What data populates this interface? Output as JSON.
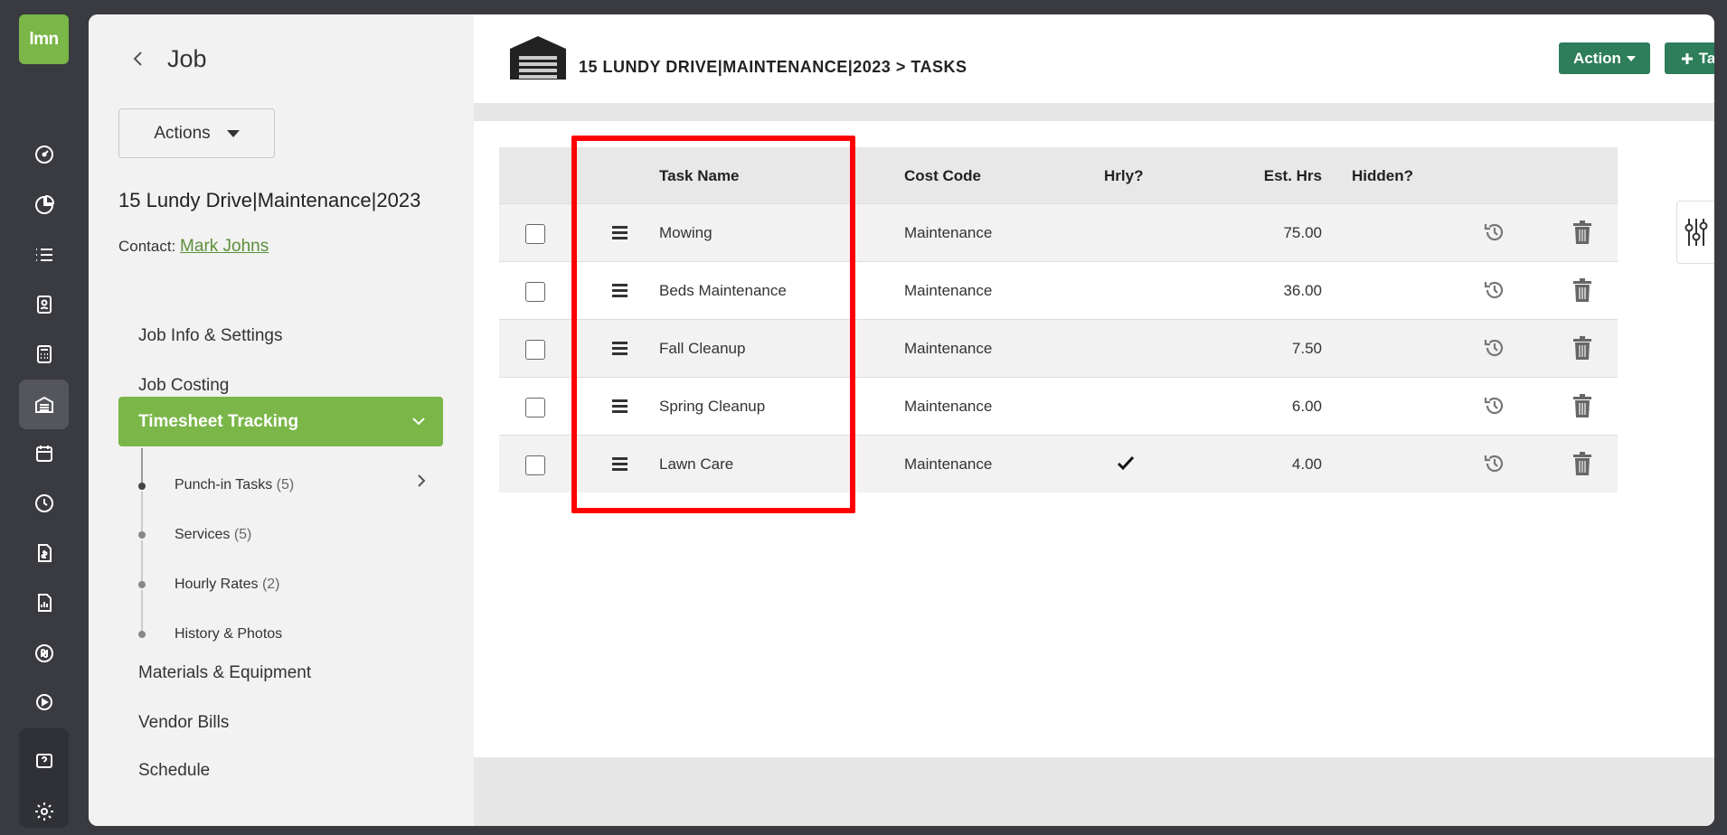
{
  "app": {
    "logo_text": "lmn"
  },
  "rail": {
    "icons": [
      "dashboard-icon",
      "pie-chart-icon",
      "list-icon",
      "contact-card-icon",
      "calculator-icon",
      "jobs-icon",
      "calendar-icon",
      "clock-icon",
      "invoice-icon",
      "report-icon",
      "quickbooks-icon",
      "play-icon",
      "help-icon",
      "settings-icon"
    ],
    "active": "jobs-icon"
  },
  "panel": {
    "title": "Job",
    "actions_label": "Actions",
    "job_name": "15 Lundy Drive|Maintenance|2023",
    "contact_label": "Contact:",
    "contact_name": "Mark Johns",
    "nav": {
      "job_info": "Job Info & Settings",
      "job_costing": "Job Costing",
      "timesheet": "Timesheet Tracking",
      "materials": "Materials & Equipment",
      "vendor_bills": "Vendor Bills",
      "schedule": "Schedule"
    },
    "sub": [
      {
        "label": "Punch-in Tasks",
        "count": "(5)"
      },
      {
        "label": "Services",
        "count": "(5)"
      },
      {
        "label": "Hourly Rates",
        "count": "(2)"
      },
      {
        "label": "History & Photos",
        "count": ""
      }
    ]
  },
  "header": {
    "breadcrumb": "15 LUNDY DRIVE|MAINTENANCE|2023 > TASKS",
    "action_label": "Action",
    "task_label": "Task"
  },
  "table": {
    "columns": {
      "task_name": "Task Name",
      "cost_code": "Cost Code",
      "hourly": "Hrly?",
      "est_hrs": "Est. Hrs",
      "hidden": "Hidden?"
    },
    "rows": [
      {
        "task_name": "Mowing",
        "cost_code": "Maintenance",
        "hourly": false,
        "est_hrs": "75.00"
      },
      {
        "task_name": "Beds Maintenance",
        "cost_code": "Maintenance",
        "hourly": false,
        "est_hrs": "36.00"
      },
      {
        "task_name": "Fall Cleanup",
        "cost_code": "Maintenance",
        "hourly": false,
        "est_hrs": "7.50"
      },
      {
        "task_name": "Spring Cleanup",
        "cost_code": "Maintenance",
        "hourly": false,
        "est_hrs": "6.00"
      },
      {
        "task_name": "Lawn Care",
        "cost_code": "Maintenance",
        "hourly": true,
        "est_hrs": "4.00"
      }
    ]
  },
  "colors": {
    "brand_green": "#7ab648",
    "button_green": "#2e7d5b",
    "highlight_red": "#ff0000",
    "rail_bg": "#3a3b40"
  }
}
